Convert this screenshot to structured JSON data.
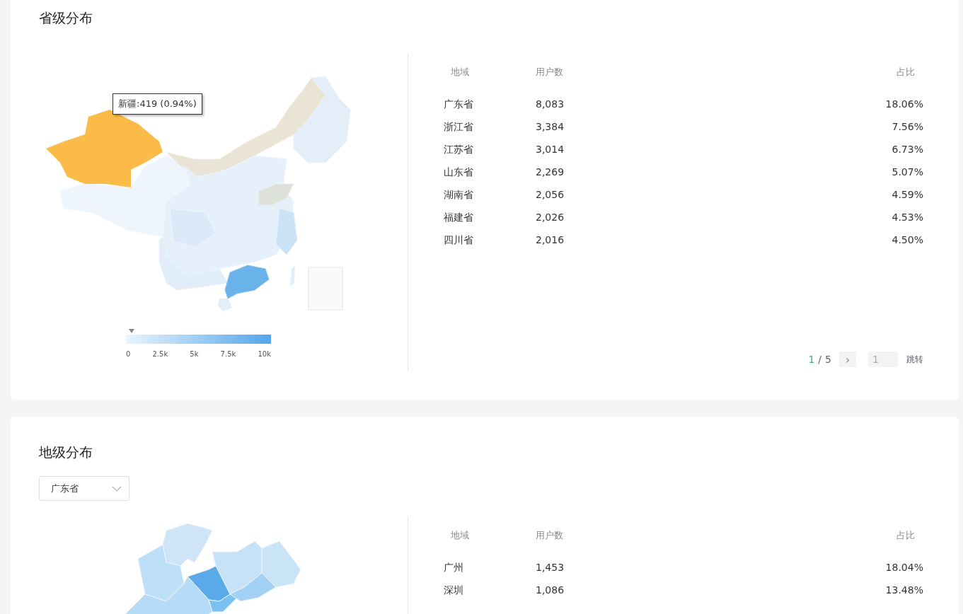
{
  "province_section": {
    "title": "省级分布",
    "tooltip": "新疆:419 (0.94%)",
    "legend": {
      "level": 0.04,
      "ticks": [
        "0",
        "2.5k",
        "5k",
        "7.5k",
        "10k"
      ]
    },
    "table": {
      "columns": [
        "地域",
        "用户数",
        "占比"
      ],
      "rows": [
        [
          "广东省",
          "8,083",
          "18.06%"
        ],
        [
          "浙江省",
          "3,384",
          "7.56%"
        ],
        [
          "江苏省",
          "3,014",
          "6.73%"
        ],
        [
          "山东省",
          "2,269",
          "5.07%"
        ],
        [
          "湖南省",
          "2,056",
          "4.59%"
        ],
        [
          "福建省",
          "2,026",
          "4.53%"
        ],
        [
          "四川省",
          "2,016",
          "4.50%"
        ]
      ]
    },
    "pagination": {
      "current": "1",
      "separator": "/",
      "total": "5",
      "next": "›",
      "page_input": "1",
      "jump": "跳转"
    }
  },
  "city_section": {
    "title": "地级分布",
    "province_select": "广东省",
    "table": {
      "columns": [
        "地域",
        "用户数",
        "占比"
      ],
      "rows": [
        [
          "广州",
          "1,453",
          "18.04%"
        ],
        [
          "深圳",
          "1,086",
          "13.48%"
        ]
      ]
    }
  }
}
